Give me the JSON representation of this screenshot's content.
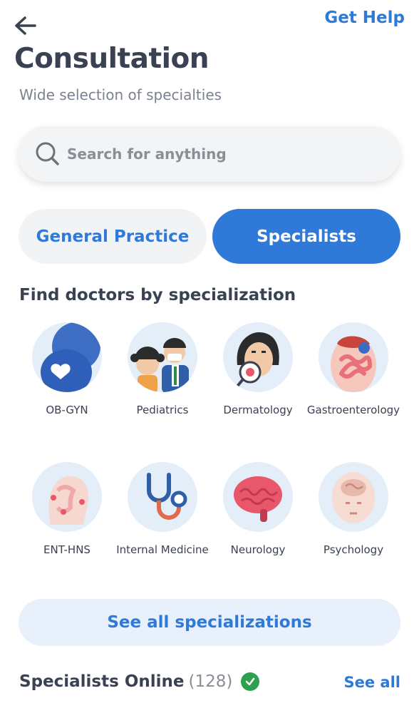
{
  "header": {
    "back_icon": "arrow-left-icon",
    "help_label": "Get Help"
  },
  "page": {
    "title": "Consultation",
    "subtitle": "Wide selection of specialties"
  },
  "search": {
    "placeholder": "Search for anything",
    "icon": "search-icon"
  },
  "tabs": [
    {
      "label": "General Practice",
      "selected": false
    },
    {
      "label": "Specialists",
      "selected": true
    }
  ],
  "section": {
    "title": "Find doctors by specialization"
  },
  "specializations": [
    {
      "label": "OB-GYN",
      "icon": "pregnancy-icon"
    },
    {
      "label": "Pediatrics",
      "icon": "children-icon"
    },
    {
      "label": "Dermatology",
      "icon": "skin-care-icon"
    },
    {
      "label": "Gastroenterology",
      "icon": "intestines-icon"
    },
    {
      "label": "ENT-HNS",
      "icon": "ent-head-icon"
    },
    {
      "label": "Internal Medicine",
      "icon": "stethoscope-icon"
    },
    {
      "label": "Neurology",
      "icon": "brain-icon"
    },
    {
      "label": "Psychology",
      "icon": "psychology-head-icon"
    }
  ],
  "see_all_specs_label": "See all specializations",
  "online": {
    "title": "Specialists Online",
    "count": "(128)",
    "see_all_label": "See all"
  },
  "colors": {
    "accent": "#2f7ad8",
    "online_green": "#2ea04f",
    "icon_bg": "#e3eef9"
  }
}
